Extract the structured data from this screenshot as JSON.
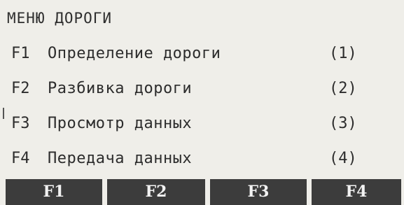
{
  "title": "МЕНЮ ДОРОГИ",
  "menu": [
    {
      "key": "F1",
      "label": "Определение дороги",
      "num": "(1)"
    },
    {
      "key": "F2",
      "label": "Разбивка дороги",
      "num": "(2)"
    },
    {
      "key": "F3",
      "label": "Просмотр данных",
      "num": "(3)"
    },
    {
      "key": "F4",
      "label": "Передача данных",
      "num": "(4)"
    }
  ],
  "softkeys": [
    "F1",
    "F2",
    "F3",
    "F4"
  ],
  "colors": {
    "background": "#efeee9",
    "text": "#2c2c2c",
    "softkey_bg": "#3c3c3c",
    "softkey_text": "#f2f2f2"
  }
}
